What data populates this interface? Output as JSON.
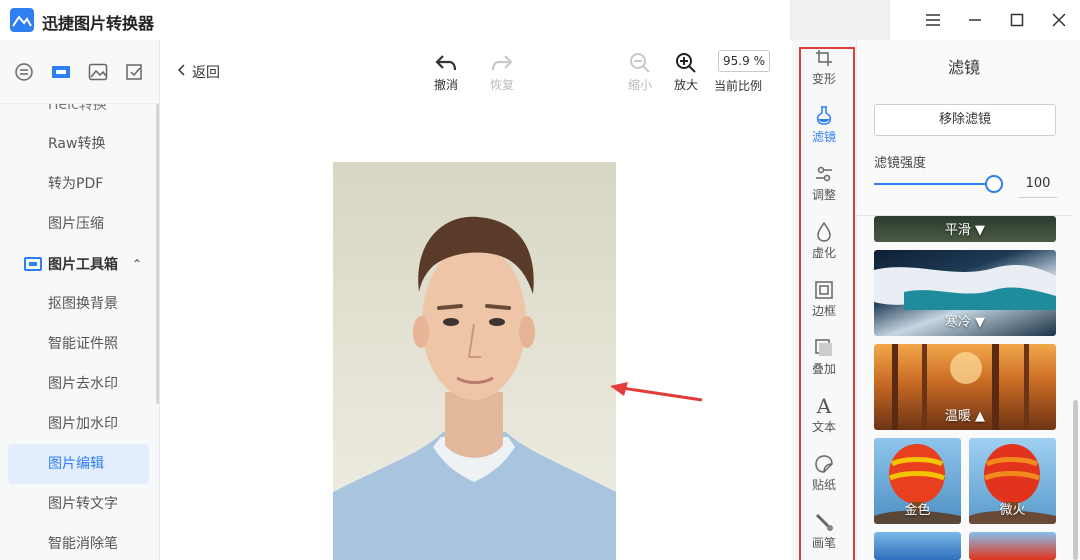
{
  "app": {
    "title": "迅捷图片转换器"
  },
  "sidebar": {
    "items": [
      {
        "label": "Heic转换",
        "cut": true
      },
      {
        "label": "Raw转换"
      },
      {
        "label": "转为PDF"
      },
      {
        "label": "图片压缩"
      }
    ],
    "group": {
      "label": "图片工具箱"
    },
    "tools": [
      {
        "label": "抠图换背景"
      },
      {
        "label": "智能证件照"
      },
      {
        "label": "图片去水印"
      },
      {
        "label": "图片加水印"
      },
      {
        "label": "图片编辑",
        "active": true
      },
      {
        "label": "图片转文字"
      },
      {
        "label": "智能消除笔"
      }
    ]
  },
  "toolbar": {
    "back": "返回",
    "undo": "撤消",
    "redo": "恢复",
    "zoom_out": "缩小",
    "zoom_in": "放大",
    "zoom_value": "95.9 %",
    "zoom_label": "当前比例"
  },
  "strip": {
    "items": [
      "变形",
      "滤镜",
      "调整",
      "虚化",
      "边框",
      "叠加",
      "文本",
      "贴纸",
      "画笔"
    ],
    "active_index": 1
  },
  "panel": {
    "title": "滤镜",
    "remove_button": "移除滤镜",
    "strength_label": "滤镜强度",
    "strength_value": "100",
    "strength_fraction": 1.0,
    "filters": [
      {
        "label": "平滑 ▼"
      },
      {
        "label": "寒冷 ▼"
      },
      {
        "label": "温暖 ▲"
      },
      {
        "label": "金色"
      },
      {
        "label": "微火"
      }
    ]
  },
  "colors": {
    "accent": "#2f7ff0",
    "highlight": "#e33c3c"
  }
}
